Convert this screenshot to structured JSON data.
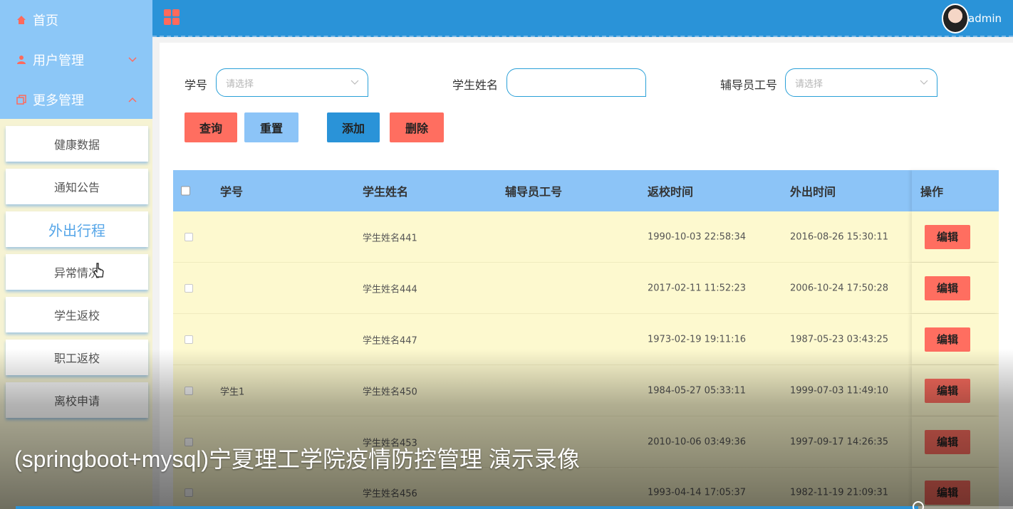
{
  "sidebar": {
    "menu": [
      {
        "label": "首页",
        "icon": "home-icon"
      },
      {
        "label": "用户管理",
        "icon": "user-icon"
      },
      {
        "label": "更多管理",
        "icon": "copy-icon"
      }
    ],
    "sub_items": [
      "健康数据",
      "通知公告",
      "外出行程",
      "异常情况",
      "学生返校",
      "职工返校",
      "离校申请"
    ],
    "active_sub": "外出行程"
  },
  "header": {
    "user": "admin"
  },
  "filters": {
    "student_id_label": "学号",
    "student_id_placeholder": "请选择",
    "student_name_label": "学生姓名",
    "student_name_value": "",
    "counselor_label": "辅导员工号",
    "counselor_placeholder": "请选择"
  },
  "buttons": {
    "query": "查询",
    "reset": "重置",
    "add": "添加",
    "delete": "删除"
  },
  "table": {
    "columns": [
      "学号",
      "学生姓名",
      "辅导员工号",
      "返校时间",
      "外出时间",
      "操作"
    ],
    "edit_label": "编辑",
    "rows": [
      {
        "student_id": "",
        "name": "学生姓名441",
        "counselor": "",
        "return_time": "1990-10-03 22:58:34",
        "out_time": "2016-08-26 15:30:11"
      },
      {
        "student_id": "",
        "name": "学生姓名444",
        "counselor": "",
        "return_time": "2017-02-11 11:52:23",
        "out_time": "2006-10-24 17:50:28"
      },
      {
        "student_id": "",
        "name": "学生姓名447",
        "counselor": "",
        "return_time": "1973-02-19 19:11:16",
        "out_time": "1987-05-23 03:43:25"
      },
      {
        "student_id": "学生1",
        "name": "学生姓名450",
        "counselor": "",
        "return_time": "1984-05-27 05:33:11",
        "out_time": "1999-07-03 11:49:10"
      },
      {
        "student_id": "",
        "name": "学生姓名453",
        "counselor": "",
        "return_time": "2010-10-06 03:49:36",
        "out_time": "1997-09-17 14:26:35"
      },
      {
        "student_id": "",
        "name": "学生姓名456",
        "counselor": "",
        "return_time": "1993-04-14 17:05:37",
        "out_time": "1982-11-19 21:09:31"
      }
    ]
  },
  "video": {
    "caption": "(springboot+mysql)宁夏理工学院疫情防控管理  演示录像",
    "progress": 0.905
  },
  "colors": {
    "primary": "#2a93d8",
    "light_blue": "#8cc4f7",
    "red": "#ff6e60",
    "row_bg": "#fdf9cf"
  }
}
